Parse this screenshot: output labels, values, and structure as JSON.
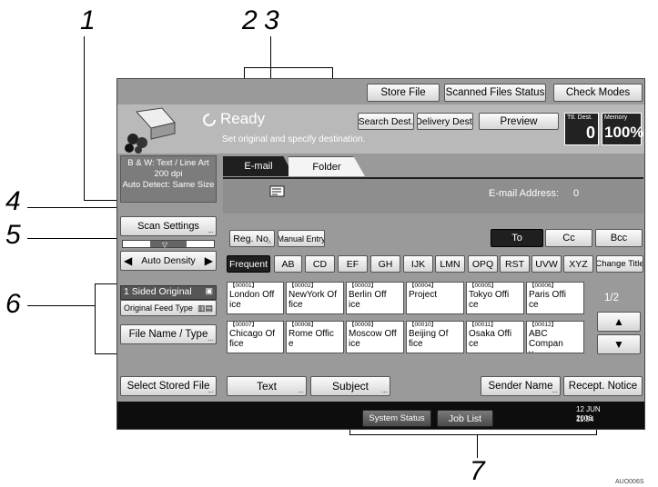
{
  "callouts": [
    "1",
    "2",
    "3",
    "4",
    "5",
    "6",
    "7"
  ],
  "top_buttons": {
    "store_file": "Store File",
    "scanned_status": "Scanned Files Status",
    "check_modes": "Check Modes"
  },
  "status": {
    "title": "Ready",
    "message": "Set original and specify destination."
  },
  "header_buttons": {
    "search_dest": "Search Dest.",
    "delivery_dest": "Delivery Dest.",
    "preview": "Preview"
  },
  "counters": {
    "ttl_label": "Ttl. Dest.",
    "ttl_value": "0",
    "memory_label": "Memory",
    "memory_value": "100%"
  },
  "tabs": {
    "email": "E-mail",
    "folder": "Folder"
  },
  "left_panel": {
    "scan_info": [
      "B & W: Text / Line Art",
      "200 dpi",
      "Auto Detect: Same Size"
    ],
    "scan_settings": "Scan Settings",
    "auto_density": "Auto Density",
    "original_sided": "1 Sided Original",
    "original_feed": "Original Feed Type",
    "file_name": "File Name / Type",
    "select_stored": "Select Stored File"
  },
  "email_address": {
    "label": "E-mail Address:",
    "count": "0"
  },
  "reg_no": "Reg. No.",
  "manual_entry": "Manual Entry",
  "recipient": {
    "to": "To",
    "cc": "Cc",
    "bcc": "Bcc"
  },
  "index_tabs": [
    "Frequent",
    "AB",
    "CD",
    "EF",
    "GH",
    "IJK",
    "LMN",
    "OPQ",
    "RST",
    "UVW",
    "XYZ"
  ],
  "change_title": "Change Title",
  "destinations": [
    {
      "num": "【00001】",
      "name": "London Off",
      "name2": "ice"
    },
    {
      "num": "【00002】",
      "name": "NewYork Of",
      "name2": "fice"
    },
    {
      "num": "【00003】",
      "name": "Berlin Off",
      "name2": "ice"
    },
    {
      "num": "【00004】",
      "name": "Project",
      "name2": ""
    },
    {
      "num": "【00005】",
      "name": "Tokyo Offi",
      "name2": "ce"
    },
    {
      "num": "【00006】",
      "name": "Paris Offi",
      "name2": "ce"
    },
    {
      "num": "【00007】",
      "name": "Chicago Of",
      "name2": "fice"
    },
    {
      "num": "【00008】",
      "name": "Rome Offic",
      "name2": "e"
    },
    {
      "num": "【00009】",
      "name": "Moscow Off",
      "name2": "ice"
    },
    {
      "num": "【00010】",
      "name": "Beijing Of",
      "name2": "fice"
    },
    {
      "num": "【00011】",
      "name": "Osaka Offi",
      "name2": "ce"
    },
    {
      "num": "【00012】",
      "name": "ABC Compan",
      "name2": "y"
    }
  ],
  "page": "1/2",
  "bottom_buttons": {
    "text": "Text",
    "subject": "Subject",
    "sender": "Sender Name",
    "recept": "Recept. Notice"
  },
  "status_bar": {
    "system_status": "System Status",
    "job_list": "Job List",
    "date": "12 JUN 2006",
    "time": "11:54"
  },
  "figure_code": "AUO006S"
}
